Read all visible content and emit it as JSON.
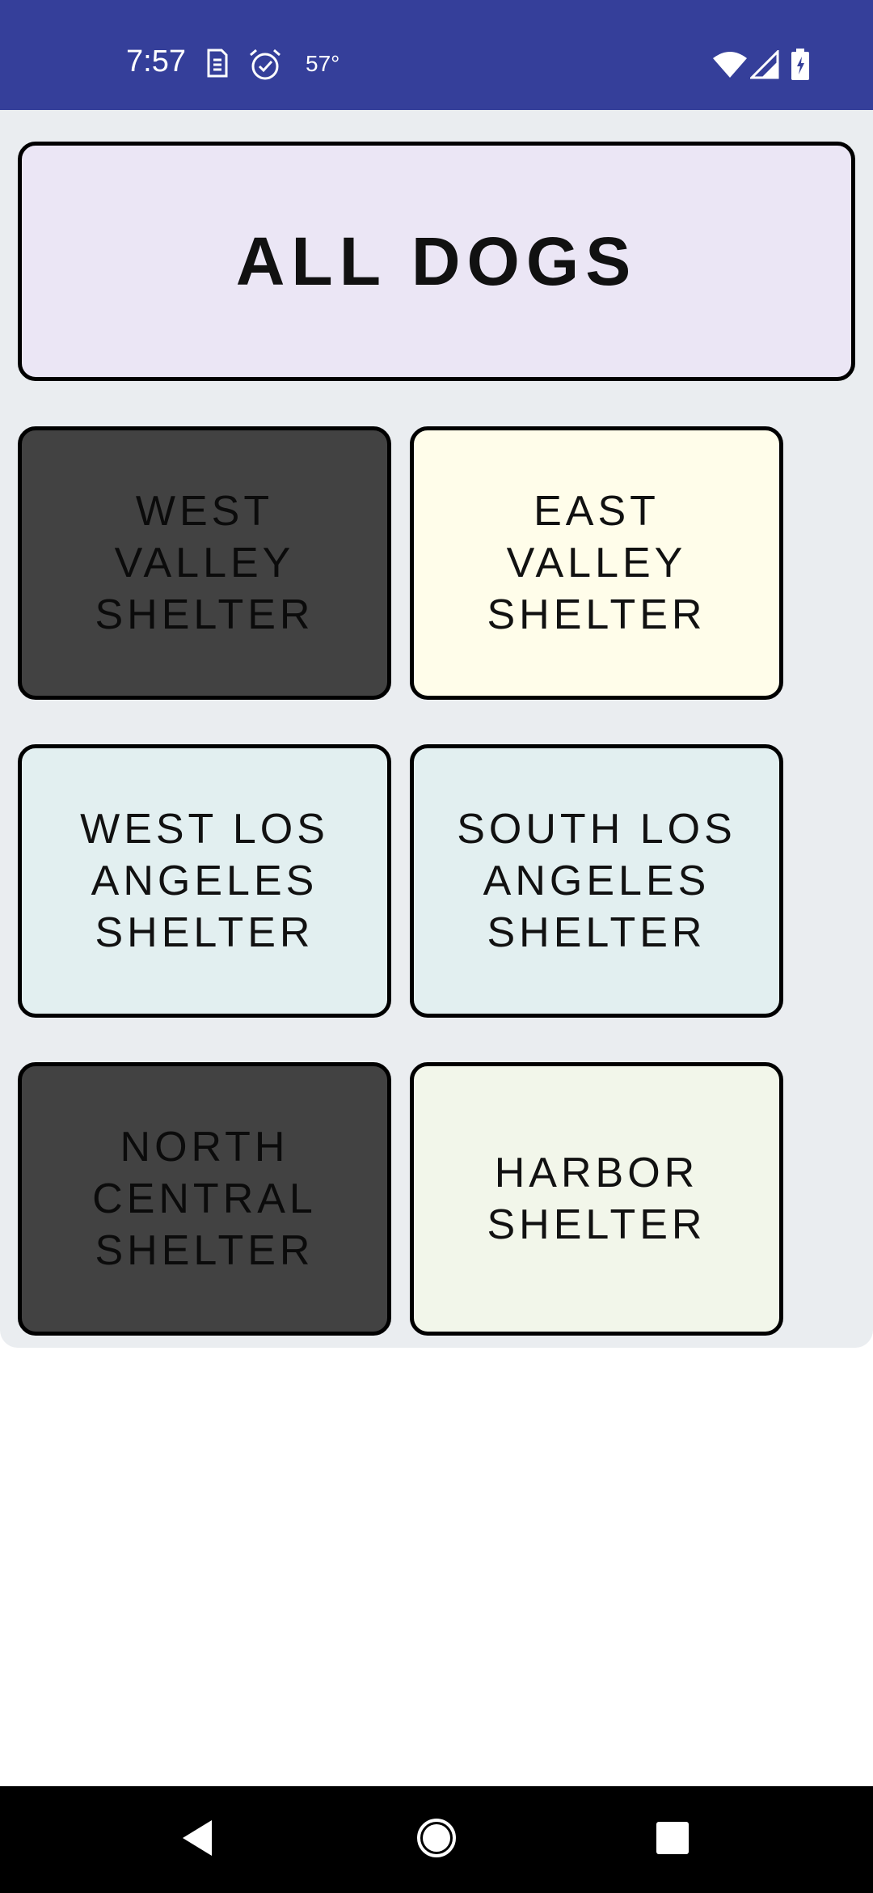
{
  "status_bar": {
    "time": "7:57",
    "temperature": "57°",
    "background": "#353f9a",
    "icons": [
      "sim-icon",
      "alarm-icon",
      "wifi-icon",
      "signal-icon",
      "battery-icon"
    ]
  },
  "tiles": {
    "all_dogs": {
      "label": "ALL DOGS",
      "background": "#ebe6f5"
    },
    "west_valley": {
      "label": "WEST VALLEY SHELTER",
      "background": "#424242"
    },
    "east_valley": {
      "label": "EAST VALLEY SHELTER",
      "background": "#fffdea"
    },
    "west_los_angeles": {
      "label": "WEST LOS ANGELES SHELTER",
      "background": "#e2eff0"
    },
    "south_los_angeles": {
      "label": "SOUTH LOS ANGELES SHELTER",
      "background": "#e2eff0"
    },
    "north_central": {
      "label": "NORTH CENTRAL SHELTER",
      "background": "#424242"
    },
    "harbor": {
      "label": "HARBOR SHELTER",
      "background": "#f2f6ea"
    }
  },
  "nav_bar": {
    "buttons": [
      "back-icon",
      "home-icon",
      "recents-icon"
    ]
  }
}
